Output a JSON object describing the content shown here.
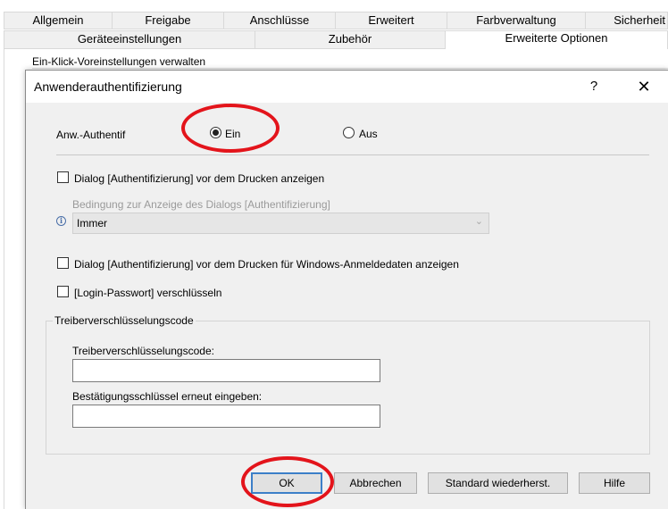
{
  "tabs_row1": [
    "Allgemein",
    "Freigabe",
    "Anschlüsse",
    "Erweitert",
    "Farbverwaltung",
    "Sicherheit"
  ],
  "tabs_row2": [
    "Geräteeinstellungen",
    "Zubehör",
    "Erweiterte Optionen"
  ],
  "active_tab": "Erweiterte Optionen",
  "background_section_label": "Ein-Klick-Voreinstellungen verwalten",
  "dialog": {
    "title": "Anwenderauthentifizierung",
    "help_symbol": "?",
    "close_symbol": "✕",
    "auth_label": "Anw.-Authentif",
    "radio_on": "Ein",
    "radio_off": "Aus",
    "selected_radio": "Ein",
    "checkbox_show_dialog": "Dialog [Authentifizierung] vor dem Drucken anzeigen",
    "condition_label": "Bedingung zur Anzeige des Dialogs [Authentifizierung]",
    "condition_value": "Immer",
    "checkbox_windows_login": "Dialog [Authentifizierung] vor dem Drucken für Windows-Anmeldedaten anzeigen",
    "checkbox_encrypt_password": "[Login-Passwort] verschlüsseln",
    "group_title": "Treiberverschlüsselungscode",
    "key_label": "Treiberverschlüsselungscode:",
    "key_value": "",
    "confirm_label": "Bestätigungsschlüssel erneut eingeben:",
    "confirm_value": "",
    "buttons": {
      "ok": "OK",
      "cancel": "Abbrechen",
      "restore_defaults": "Standard wiederherst.",
      "help": "Hilfe"
    }
  },
  "colors": {
    "dialog_background": "#f0f0f0",
    "annotation_red": "#e3141b",
    "default_button_border": "#3c7fc8"
  },
  "icons": [
    "info-icon",
    "chevron-down-icon",
    "close-icon",
    "help-icon"
  ]
}
